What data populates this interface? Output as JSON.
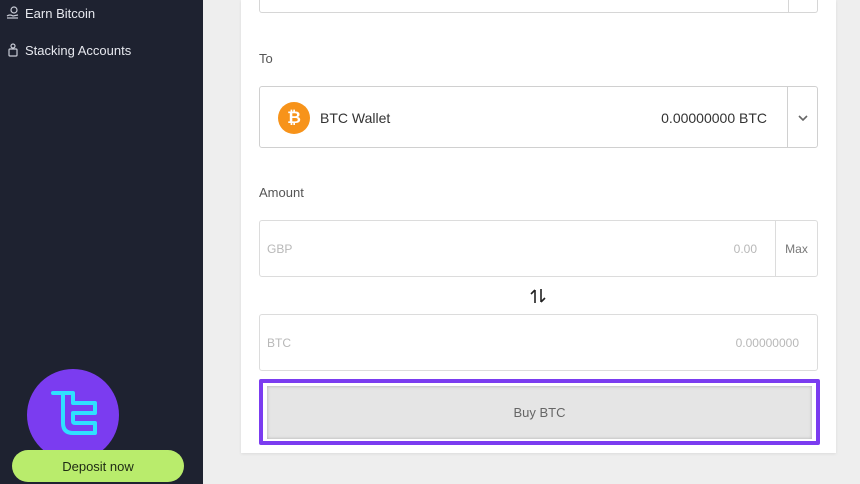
{
  "sidebar": {
    "items": [
      {
        "label": "Earn Bitcoin",
        "icon": "hand-coin-icon"
      },
      {
        "label": "Stacking Accounts",
        "icon": "piggy-bank-icon"
      }
    ],
    "deposit_label": "Deposit now",
    "badge_icon": "broker-logo-icon"
  },
  "form": {
    "to_label": "To",
    "wallet": {
      "name": "BTC Wallet",
      "balance": "0.00000000 BTC",
      "coin_symbol": "₿"
    },
    "amount_label": "Amount",
    "gbp_field": {
      "currency": "GBP",
      "value": "0.00",
      "max_label": "Max"
    },
    "btc_field": {
      "currency": "BTC",
      "value": "0.00000000"
    },
    "buy_label": "Buy BTC"
  },
  "colors": {
    "sidebar_bg": "#1e2230",
    "accent_purple": "#7b3cf0",
    "deposit_green": "#b9ec6c",
    "bitcoin_orange": "#f7931a",
    "logo_cyan": "#2fe0ff"
  }
}
